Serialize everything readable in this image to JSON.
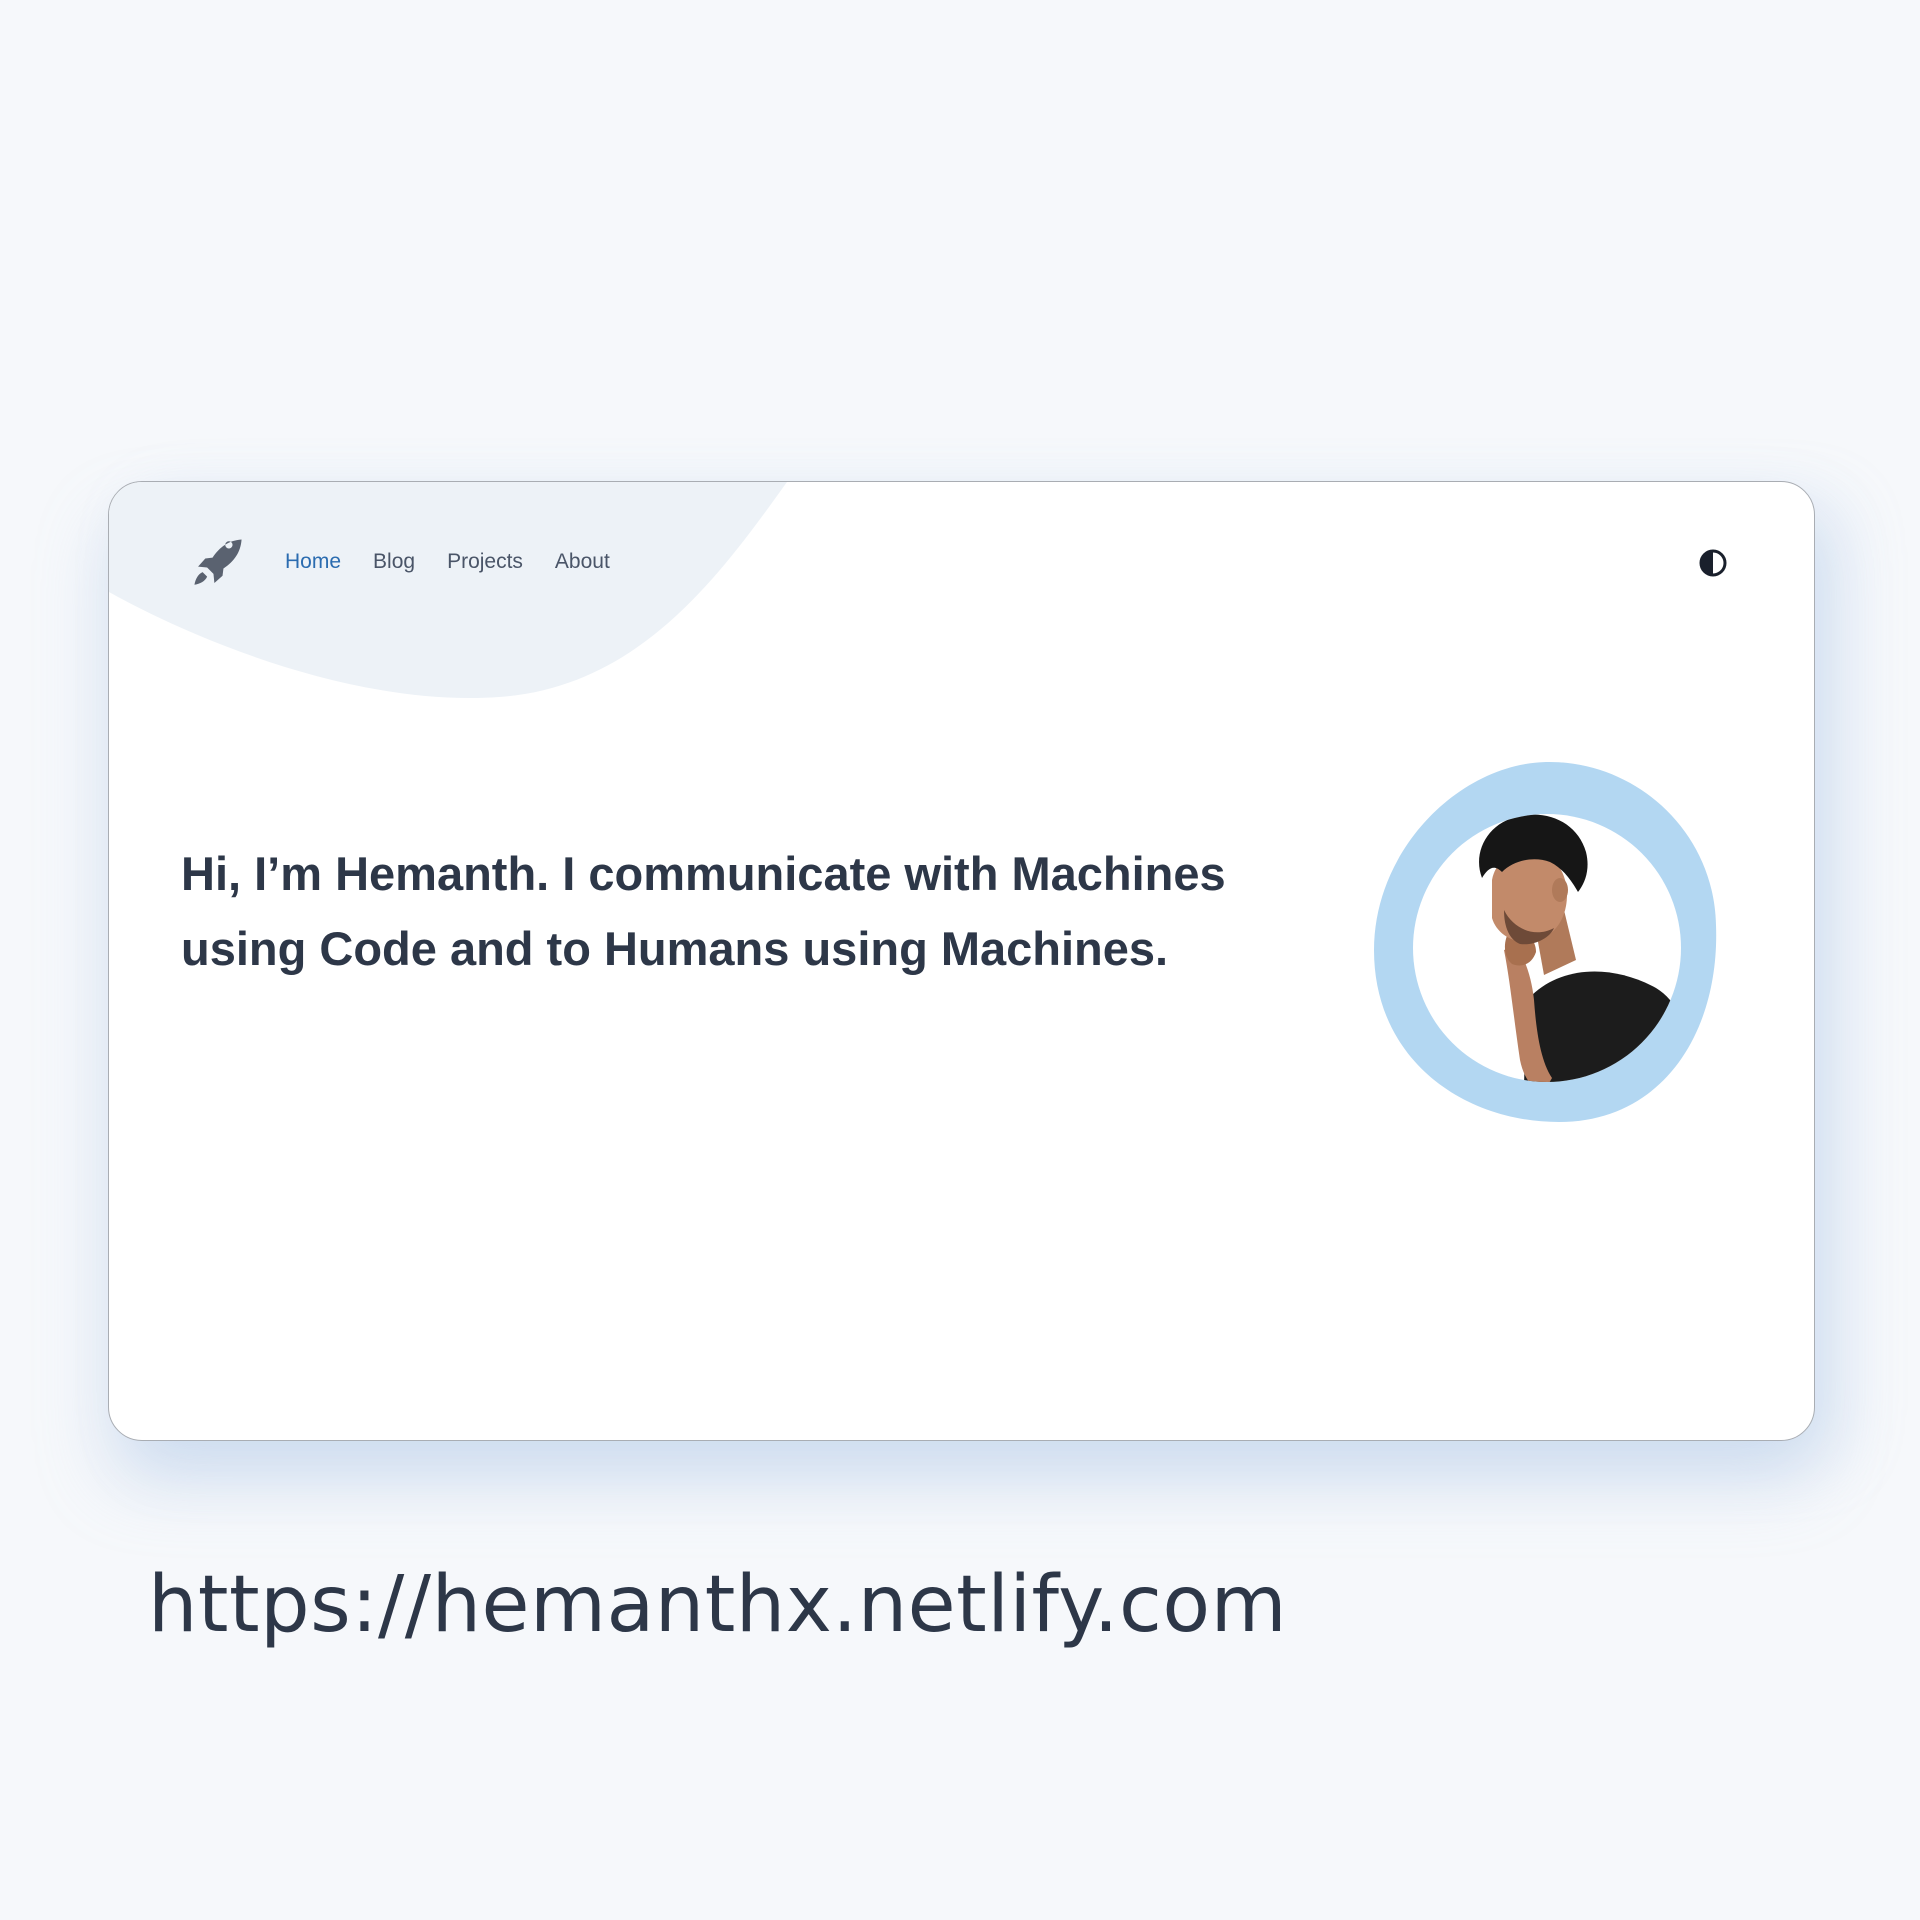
{
  "nav": {
    "items": [
      {
        "label": "Home",
        "active": true
      },
      {
        "label": "Blog",
        "active": false
      },
      {
        "label": "Projects",
        "active": false
      },
      {
        "label": "About",
        "active": false
      }
    ]
  },
  "icons": {
    "logo": "rocket-icon",
    "theme_toggle": "contrast-icon"
  },
  "hero": {
    "headline": "Hi, I’m Hemanth. I communicate with Machines using Code and to Humans using Machines."
  },
  "footer": {
    "url": "https://hemanthx.netlify.com"
  },
  "colors": {
    "page_background": "#f6f8fb",
    "card_background": "#ffffff",
    "blob": "#edf2f7",
    "nav_active": "#2b6cb0",
    "nav_text": "#4a5568",
    "headline": "#2d3748",
    "avatar_ring": "#b3d7f2",
    "icon": "#5a6270"
  }
}
